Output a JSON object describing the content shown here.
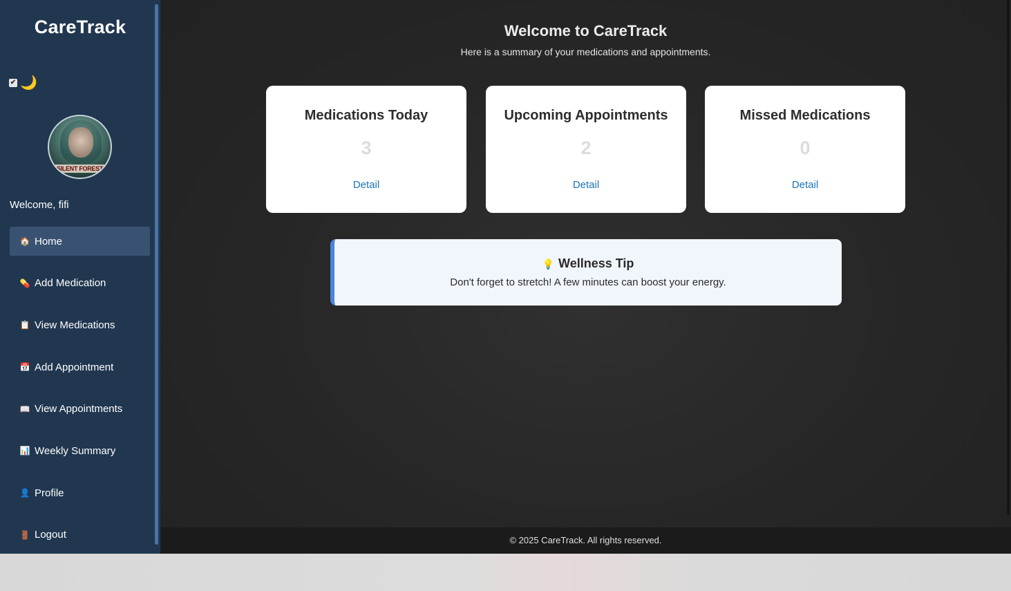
{
  "sidebar": {
    "brand": "CareTrack",
    "theme_toggle": {
      "checkbox_glyph": "✔",
      "moon_glyph": "🌙",
      "checked": true
    },
    "avatar": {
      "caption": "SILENT FOREST"
    },
    "welcome": "Welcome, fifi",
    "items": [
      {
        "label": "Home",
        "icon": "🏠",
        "icon_name": "home-icon"
      },
      {
        "label": "Add Medication",
        "icon": "💊",
        "icon_name": "pill-icon"
      },
      {
        "label": "View Medications",
        "icon": "📋",
        "icon_name": "clipboard-icon"
      },
      {
        "label": "Add Appointment",
        "icon": "📅",
        "icon_name": "calendar-icon"
      },
      {
        "label": "View Appointments",
        "icon": "📖",
        "icon_name": "book-icon"
      },
      {
        "label": "Weekly Summary",
        "icon": "📊",
        "icon_name": "bar-chart-icon"
      },
      {
        "label": "Profile",
        "icon": "👤",
        "icon_name": "user-icon"
      },
      {
        "label": "Logout",
        "icon": "🚪",
        "icon_name": "door-icon"
      }
    ],
    "active_item": "Home"
  },
  "main": {
    "title": "Welcome to CareTrack",
    "subtitle": "Here is a summary of your medications and appointments.",
    "cards": [
      {
        "title": "Medications Today",
        "value": "3",
        "link": "Detail"
      },
      {
        "title": "Upcoming Appointments",
        "value": "2",
        "link": "Detail"
      },
      {
        "title": "Missed Medications",
        "value": "0",
        "link": "Detail"
      }
    ],
    "tip": {
      "icon": "💡",
      "title": "Wellness Tip",
      "body": "Don't forget to stretch! A few minutes can boost your energy."
    },
    "footer": "© 2025 CareTrack. All rights reserved."
  },
  "colors": {
    "sidebar_bg": "#213750",
    "main_bg": "#262626",
    "link": "#1a73b8",
    "tip_accent": "#4a86d8"
  }
}
